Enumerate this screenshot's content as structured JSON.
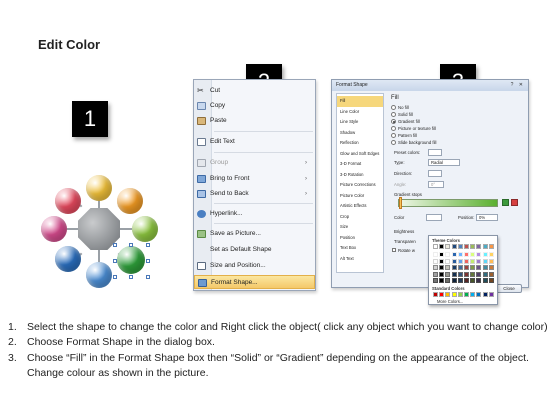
{
  "title": "Edit Color",
  "badges": [
    "1",
    "2",
    "3"
  ],
  "diagram": {
    "circle_colors": [
      "#f2c23a",
      "#f39c24",
      "#8dc63f",
      "#2e9e3a",
      "#4c8fd6",
      "#2a6fc0",
      "#d64b8e",
      "#e84a5f"
    ],
    "center_color": "#7a7e82"
  },
  "context_menu": {
    "items": [
      {
        "label": "Cut",
        "icon": "scissors-icon",
        "enabled": true
      },
      {
        "label": "Copy",
        "icon": "copy-icon",
        "enabled": true
      },
      {
        "label": "Paste",
        "icon": "paste-icon",
        "enabled": true
      },
      {
        "label": "Edit Text",
        "icon": "edit-text-icon",
        "enabled": true
      },
      {
        "label": "Group",
        "icon": "group-icon",
        "enabled": false,
        "submenu": true
      },
      {
        "label": "Bring to Front",
        "icon": "bring-front-icon",
        "enabled": true,
        "submenu": true
      },
      {
        "label": "Send to Back",
        "icon": "send-back-icon",
        "enabled": true,
        "submenu": true
      },
      {
        "label": "Hyperlink...",
        "icon": "hyperlink-icon",
        "enabled": true
      },
      {
        "label": "Save as Picture...",
        "icon": "save-picture-icon",
        "enabled": true
      },
      {
        "label": "Set as Default Shape",
        "icon": "",
        "enabled": true
      },
      {
        "label": "Size and Position...",
        "icon": "size-position-icon",
        "enabled": true
      },
      {
        "label": "Format Shape...",
        "icon": "format-shape-icon",
        "enabled": true,
        "highlighted": true
      }
    ]
  },
  "format_dialog": {
    "title": "Format Shape",
    "nav_items": [
      "Fill",
      "Line Color",
      "Line Style",
      "Shadow",
      "Reflection",
      "Glow and Soft Edges",
      "3-D Format",
      "3-D Rotation",
      "Picture Corrections",
      "Picture Color",
      "Artistic Effects",
      "Crop",
      "Size",
      "Position",
      "Text Box",
      "Alt Text"
    ],
    "section_title": "Fill",
    "fill_options": [
      "No fill",
      "Solid fill",
      "Gradient fill",
      "Picture or texture fill",
      "Pattern fill",
      "Slide background fill"
    ],
    "selected_fill": "Gradient fill",
    "preset_label": "Preset colors:",
    "type_label": "Type:",
    "type_value": "Radial",
    "direction_label": "Direction:",
    "angle_label": "Angle:",
    "angle_value": "0°",
    "gradient_stops_label": "Gradient stops",
    "color_label": "Color",
    "position_label": "Position:",
    "position_value": "0%",
    "brightness_label": "Brightness",
    "transparency_label": "Transparen",
    "rotate_label": "Rotate w",
    "theme_colors_label": "Theme Colors",
    "standard_colors_label": "Standard Colors",
    "more_colors_label": "More Colors...",
    "close_label": "Close",
    "gradient_end_color": "#5bb030",
    "highlight_color": "#f6d77c"
  },
  "instructions": [
    {
      "num": "1.",
      "text": "Select the shape to change the color and Right click the object( click any object which you want to change color)"
    },
    {
      "num": "2.",
      "text": "Choose Format Shape in the dialog box."
    },
    {
      "num": "3.",
      "text": "Choose “Fill” in the Format Shape box then “Solid” or “Gradient” depending on the appearance of the object. Change colour as shown in the picture."
    }
  ]
}
